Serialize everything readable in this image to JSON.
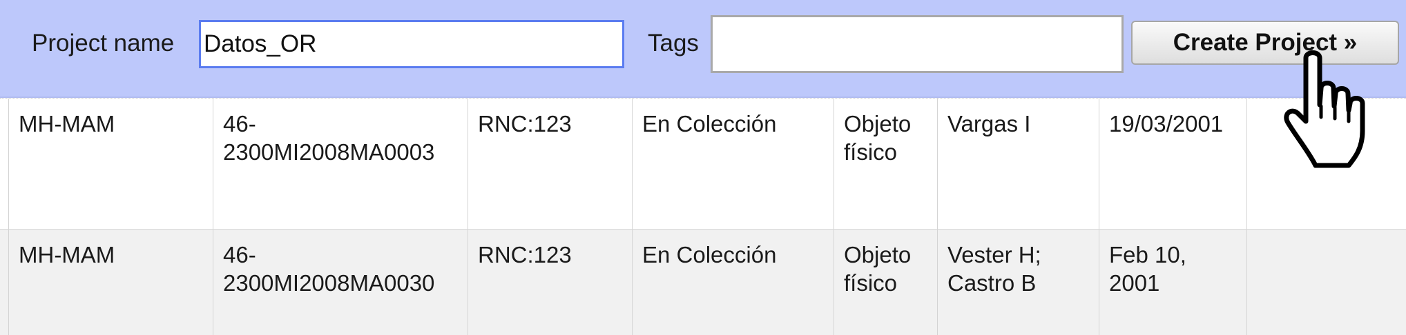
{
  "toolbar": {
    "project_name_label": "Project name",
    "project_name_value": "Datos_OR",
    "tags_label": "Tags",
    "tags_value": "",
    "create_button_label": "Create Project »"
  },
  "table": {
    "rows": [
      [
        "MH-MAM",
        "46-\n2300MI2008MA0003",
        "RNC:123",
        "En Colección",
        "Objeto\nfísico",
        "Vargas I",
        "19/03/2001",
        ""
      ],
      [
        "MH-MAM",
        "46-\n2300MI2008MA0030",
        "RNC:123",
        "En Colección",
        "Objeto\nfísico",
        "Vester H;\nCastro B",
        "Feb 10,\n2001",
        ""
      ]
    ]
  },
  "cursor": {
    "icon": "hand-pointer-icon"
  },
  "colors": {
    "toolbar_background": "#bdc8fb",
    "focused_input_border": "#5b7cf0",
    "alt_row_background": "#f1f1f1"
  }
}
